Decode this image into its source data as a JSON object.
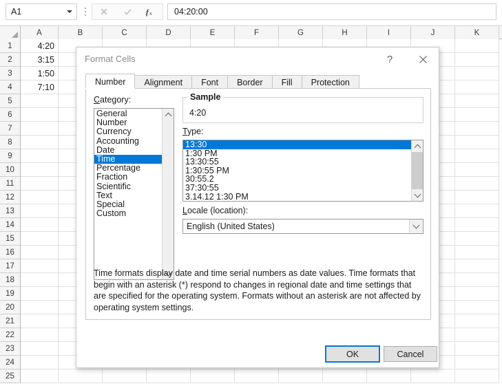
{
  "formula_bar": {
    "name_box_value": "A1",
    "cancel_icon": "x-icon",
    "enter_icon": "check-icon",
    "function_icon": "fx-icon",
    "formula_value": "04:20:00"
  },
  "sheet": {
    "columns": [
      "A",
      "B",
      "C",
      "D",
      "E",
      "F",
      "G",
      "H",
      "I",
      "J",
      "K"
    ],
    "rows": [
      "1",
      "2",
      "3",
      "4",
      "5",
      "6",
      "7",
      "8",
      "9",
      "10",
      "11",
      "12",
      "13",
      "14",
      "15",
      "16",
      "17",
      "18",
      "19",
      "20",
      "21",
      "22",
      "23",
      "24",
      "25"
    ],
    "cells": {
      "A1": "4:20",
      "A2": "3:15",
      "A3": "1:50",
      "A4": "7:10"
    }
  },
  "dialog": {
    "title": "Format Cells",
    "help_label": "?",
    "close_icon": "close-icon",
    "tabs": [
      {
        "label": "Number",
        "active": true
      },
      {
        "label": "Alignment",
        "active": false
      },
      {
        "label": "Font",
        "active": false
      },
      {
        "label": "Border",
        "active": false
      },
      {
        "label": "Fill",
        "active": false
      },
      {
        "label": "Protection",
        "active": false
      }
    ],
    "category": {
      "label": "Category:",
      "items": [
        "General",
        "Number",
        "Currency",
        "Accounting",
        "Date",
        "Time",
        "Percentage",
        "Fraction",
        "Scientific",
        "Text",
        "Special",
        "Custom"
      ],
      "selected": "Time"
    },
    "sample": {
      "legend": "Sample",
      "value": "4:20"
    },
    "type": {
      "label": "Type:",
      "items": [
        "13:30",
        "1:30 PM",
        "13:30:55",
        "1:30:55 PM",
        "30:55.2",
        "37:30:55",
        "3.14.12 1:30 PM"
      ],
      "selected": "13:30"
    },
    "locale": {
      "label": "Locale (location):",
      "value": "English (United States)",
      "arrow_icon": "chevron-down-icon"
    },
    "description": "Time formats display date and time serial numbers as date values.  Time formats that begin with an asterisk (*) respond to changes in regional date and time settings that are specified for the operating system. Formats without an asterisk are not affected by operating system settings.",
    "buttons": {
      "ok": "OK",
      "cancel": "Cancel"
    }
  },
  "colors": {
    "accent": "#0078d7",
    "selection_text": "#ffffff",
    "dialog_bg": "#ffffff",
    "grid_line": "#e0e0e0",
    "header_bg": "#f5f5f5"
  }
}
